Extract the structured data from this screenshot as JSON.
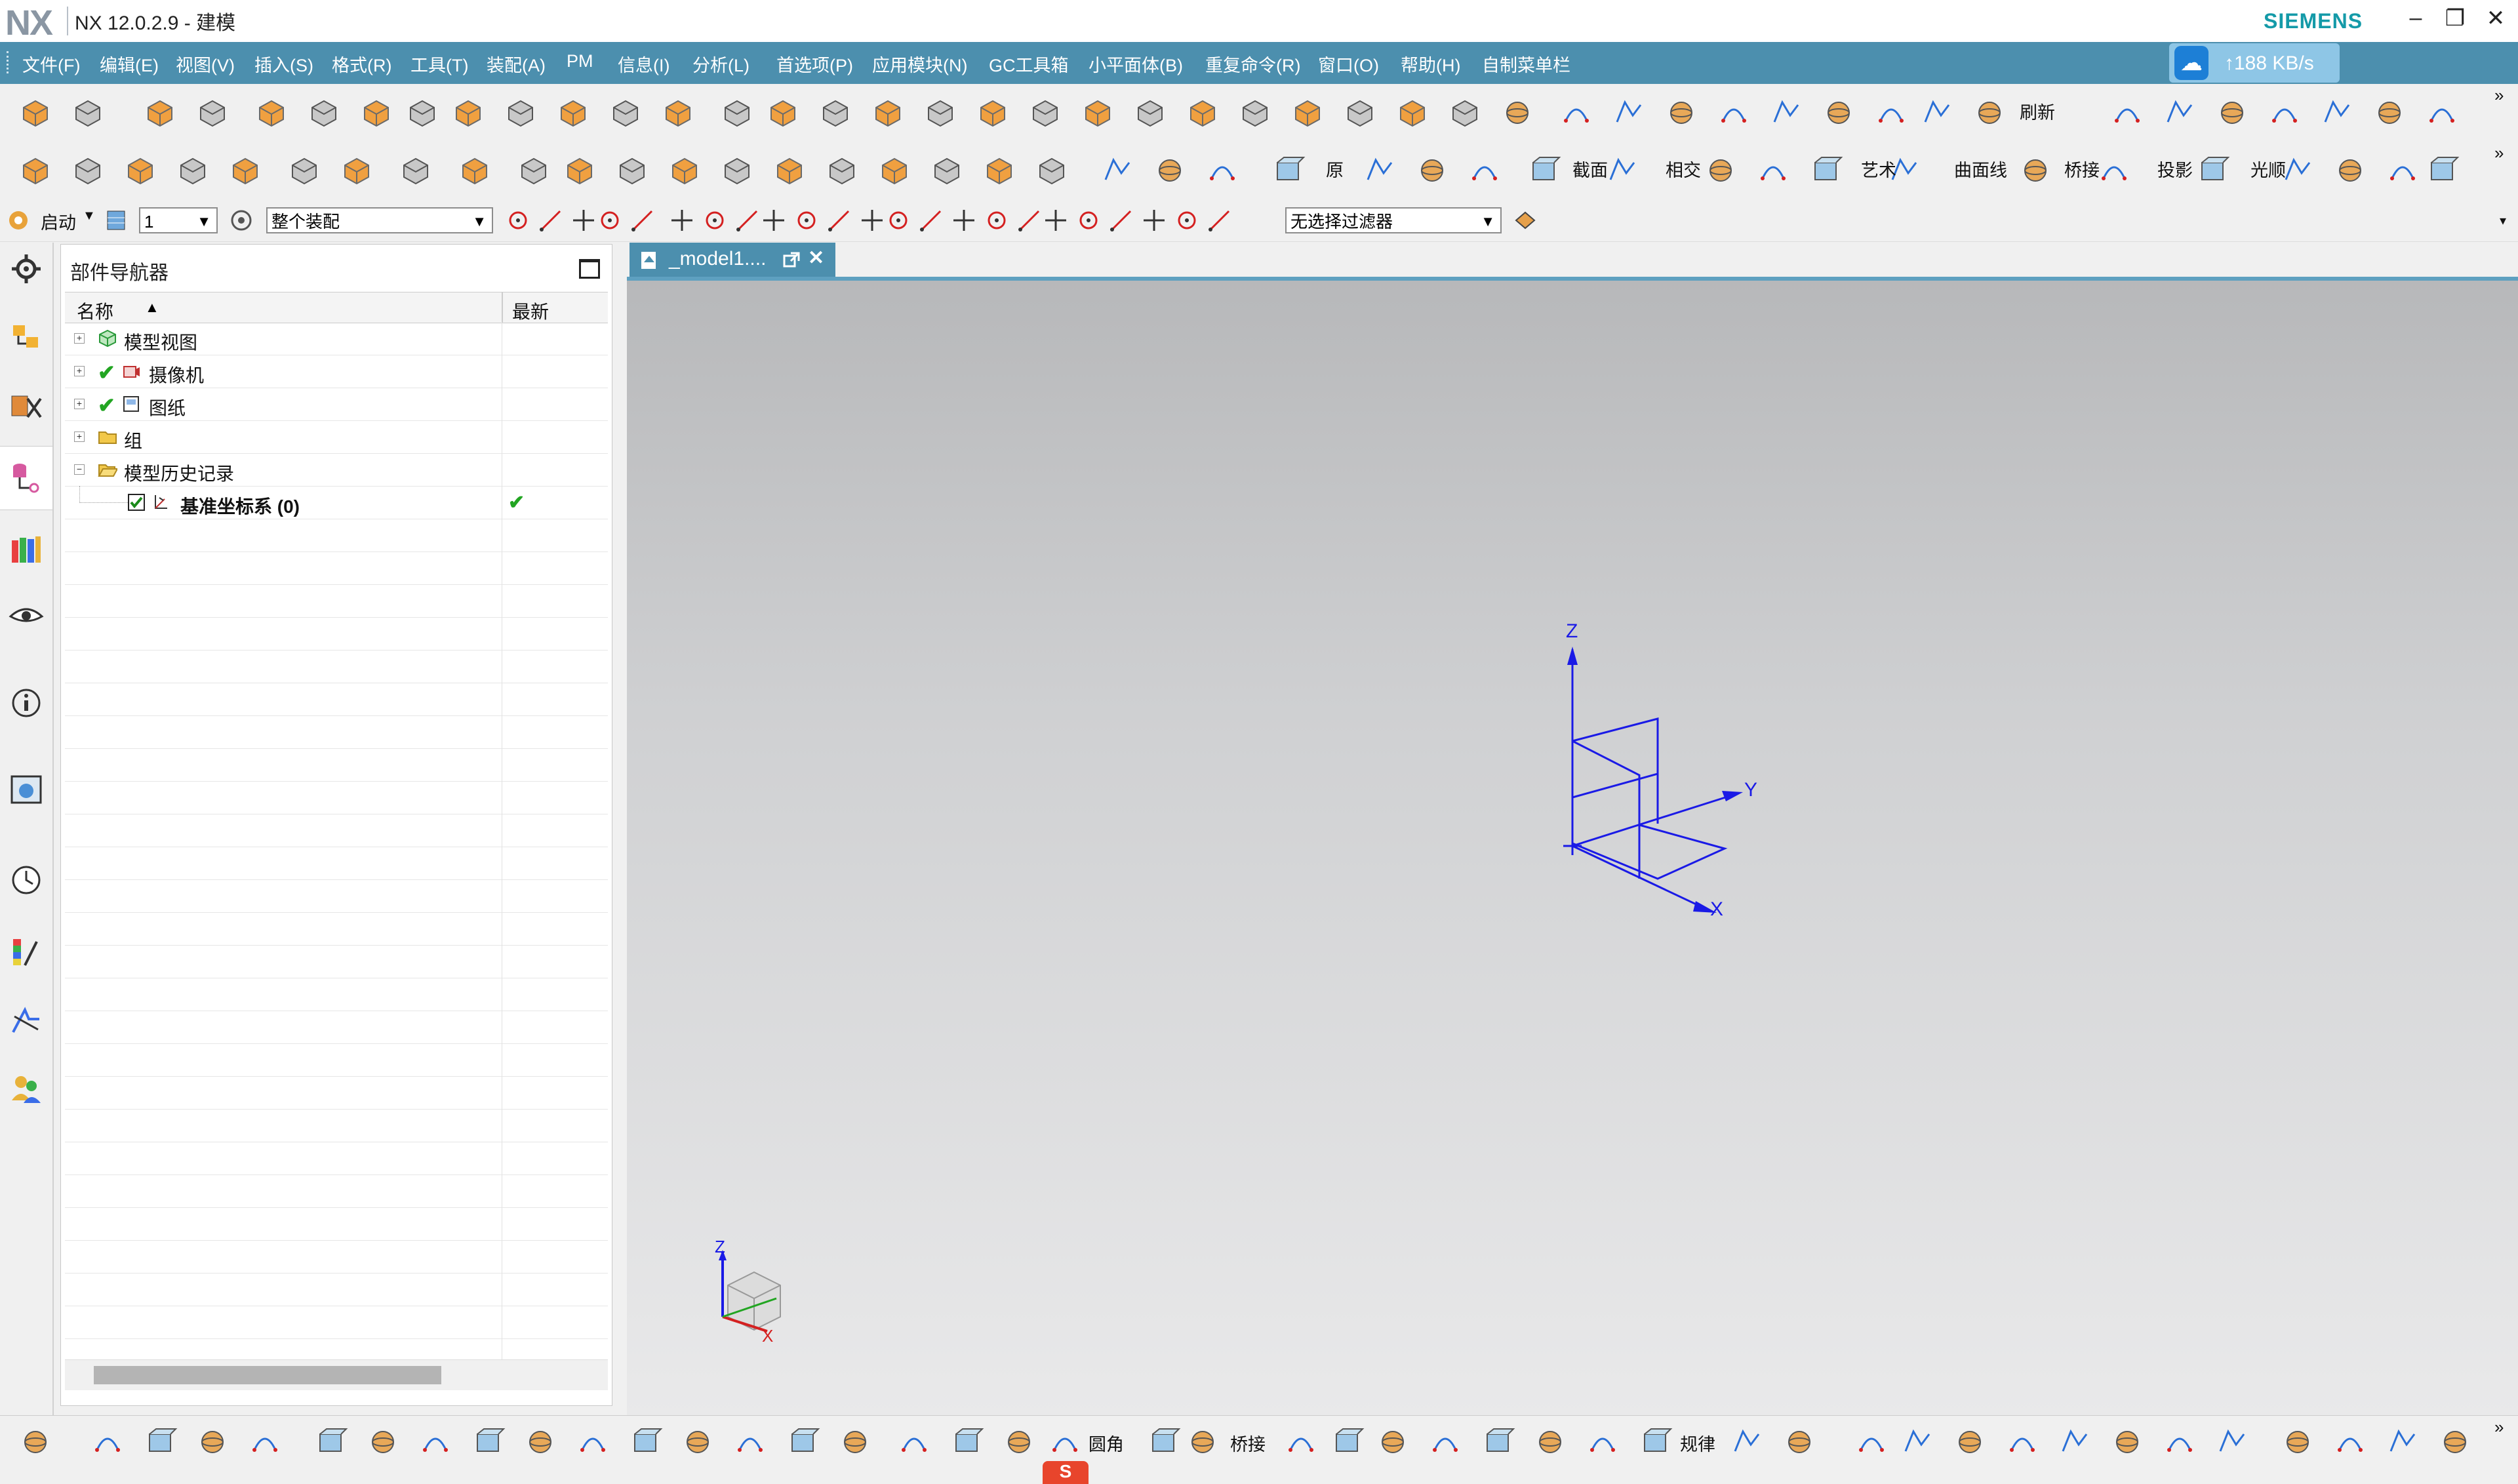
{
  "window": {
    "logo": "NX",
    "title": "NX 12.0.2.9 - 建模",
    "brand": "SIEMENS",
    "minimize": "–",
    "restore": "❐",
    "close": "✕"
  },
  "menubar": {
    "items": [
      "文件(F)",
      "编辑(E)",
      "视图(V)",
      "插入(S)",
      "格式(R)",
      "工具(T)",
      "装配(A)",
      "PM",
      "信息(I)",
      "分析(L)",
      "首选项(P)",
      "应用模块(N)",
      "GC工具箱",
      "小平面体(B)",
      "重复命令(R)",
      "窗口(O)",
      "帮助(H)",
      "自制菜单栏"
    ]
  },
  "speed_badge": {
    "icon": "cloud-icon",
    "text": "↑188 KB/s"
  },
  "toolbar1": {
    "refresh_label": "刷新"
  },
  "toolbar2": {
    "labels": [
      "原",
      "截面",
      "相交",
      "艺术",
      "曲面线",
      "桥接",
      "投影",
      "光顺"
    ]
  },
  "selection_bar": {
    "start_label": "启动",
    "layer_value": "1",
    "scope_value": "整个装配",
    "filter_value": "无选择过滤器"
  },
  "navigator": {
    "title": "部件导航器",
    "col_name": "名称",
    "col_latest": "最新",
    "rows": [
      {
        "label": "模型视图",
        "expander": "+",
        "check": ""
      },
      {
        "label": "摄像机",
        "expander": "+",
        "check": "✔"
      },
      {
        "label": "图纸",
        "expander": "+",
        "check": "✔"
      },
      {
        "label": "组",
        "expander": "+",
        "check": ""
      },
      {
        "label": "模型历史记录",
        "expander": "−",
        "check": ""
      },
      {
        "label": "基准坐标系 (0)",
        "expander": "",
        "check": "",
        "latest": "✔"
      }
    ]
  },
  "document_tab": {
    "label": "_model1....",
    "close": "✕"
  },
  "csys": {
    "x": "X",
    "y": "Y",
    "z": "Z"
  },
  "bottom_toolbar": {
    "labels": [
      "圆角",
      "桥接",
      "规律"
    ]
  },
  "colors": {
    "accent": "#4c8fae",
    "csys": "#1a1ae6",
    "check": "#22a522",
    "brand": "#149aa8"
  }
}
